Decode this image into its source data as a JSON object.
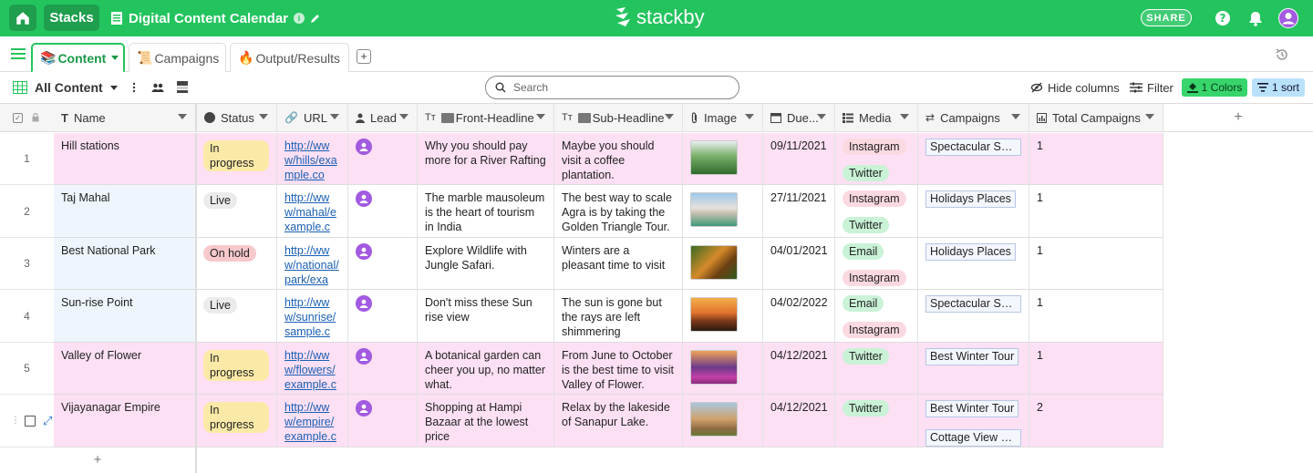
{
  "topbar": {
    "stacks_label": "Stacks",
    "title": "Digital Content Calendar",
    "logo_text": "stackby",
    "share_label": "SHARE"
  },
  "tabs": [
    {
      "label": "Content",
      "emoji": "📚",
      "active": true
    },
    {
      "label": "Campaigns",
      "emoji": "📜",
      "active": false
    },
    {
      "label": "Output/Results",
      "emoji": "🔥",
      "active": false
    }
  ],
  "toolbar": {
    "view_name": "All Content",
    "search_placeholder": "Search",
    "hide_columns": "Hide columns",
    "filter": "Filter",
    "colors": "1 Colors",
    "sort": "1 sort"
  },
  "columns": [
    "Name",
    "Status",
    "URL",
    "Lead",
    "Front-Headline",
    "Sub-Headline",
    "Image",
    "Due...",
    "Media",
    "Campaigns",
    "Total Campaigns"
  ],
  "rows": [
    {
      "num": "1",
      "name": "Hill stations",
      "status": "In progress",
      "url": "http://www/hills/example.co",
      "front": "Why you should pay more for a River Rafting",
      "sub": "Maybe you should visit a coffee plantation.",
      "due": "09/11/2021",
      "media": [
        "Instagram",
        "Twitter"
      ],
      "campaigns": [
        "Spectacular Su..."
      ],
      "total": "1",
      "highlight": true
    },
    {
      "num": "2",
      "name": "Taj Mahal",
      "status": "Live",
      "url": "http://www/mahal/example.c",
      "front": "The marble mausoleum is the heart of tourism in India",
      "sub": "The best way to scale Agra is by taking the Golden Triangle Tour.",
      "due": "27/11/2021",
      "media": [
        "Instagram",
        "Twitter"
      ],
      "campaigns": [
        "Holidays Places"
      ],
      "total": "1",
      "highlight": false
    },
    {
      "num": "3",
      "name": "Best National Park",
      "status": "On hold",
      "url": "http://www/national/park/exa",
      "front": "Explore Wildlife with Jungle Safari.",
      "sub": "Winters are a pleasant time to visit",
      "due": "04/01/2021",
      "media": [
        "Email",
        "Instagram"
      ],
      "campaigns": [
        "Holidays Places"
      ],
      "total": "1",
      "highlight": false
    },
    {
      "num": "4",
      "name": "Sun-rise Point",
      "status": "Live",
      "url": "http://www/sunrise/sample.c",
      "front": "Don't miss these Sun rise view",
      "sub": "The sun is gone but the rays are left shimmering",
      "due": "04/02/2022",
      "media": [
        "Email",
        "Instagram"
      ],
      "campaigns": [
        "Spectacular Su..."
      ],
      "total": "1",
      "highlight": false
    },
    {
      "num": "5",
      "name": "Valley of Flower",
      "status": "In progress",
      "url": "http://www/flowers/example.c",
      "front": "A botanical garden can cheer you up, no matter what.",
      "sub": "From June to October is the best time to visit Valley of Flower.",
      "due": "04/12/2021",
      "media": [
        "Twitter"
      ],
      "campaigns": [
        "Best Winter Tour"
      ],
      "total": "1",
      "highlight": true
    },
    {
      "num": "",
      "name": "Vijayanagar Empire",
      "status": "In progress",
      "url": "http://www/empire/example.c",
      "front": "Shopping at Hampi Bazaar at the lowest price",
      "sub": "Relax by the lakeside of Sanapur Lake.",
      "due": "04/12/2021",
      "media": [
        "Twitter"
      ],
      "campaigns": [
        "Best Winter Tour",
        "Cottage View Pl..."
      ],
      "total": "2",
      "highlight": true
    }
  ],
  "colors": {
    "brand": "#23c45e",
    "highlight_row": "#fde0f4",
    "name_cell_plain": "#eef5fc",
    "status": {
      "In progress": "#fbeaa7",
      "Live": "#ebebeb",
      "On hold": "#f7c9cc"
    },
    "media": {
      "Instagram": "#fbd9e0",
      "Twitter": "#c9f2d6",
      "Email": "#c9f2d6"
    }
  },
  "icons": [
    "home-icon",
    "doc-icon",
    "info-icon",
    "pencil-icon",
    "help-icon",
    "bell-icon",
    "user-avatar-icon",
    "menu-icon",
    "history-icon",
    "grid-icon",
    "more-icon",
    "people-icon",
    "print-icon",
    "search-icon",
    "eye-slash-icon",
    "filter-icon",
    "paint-bucket-icon",
    "sort-icon"
  ]
}
